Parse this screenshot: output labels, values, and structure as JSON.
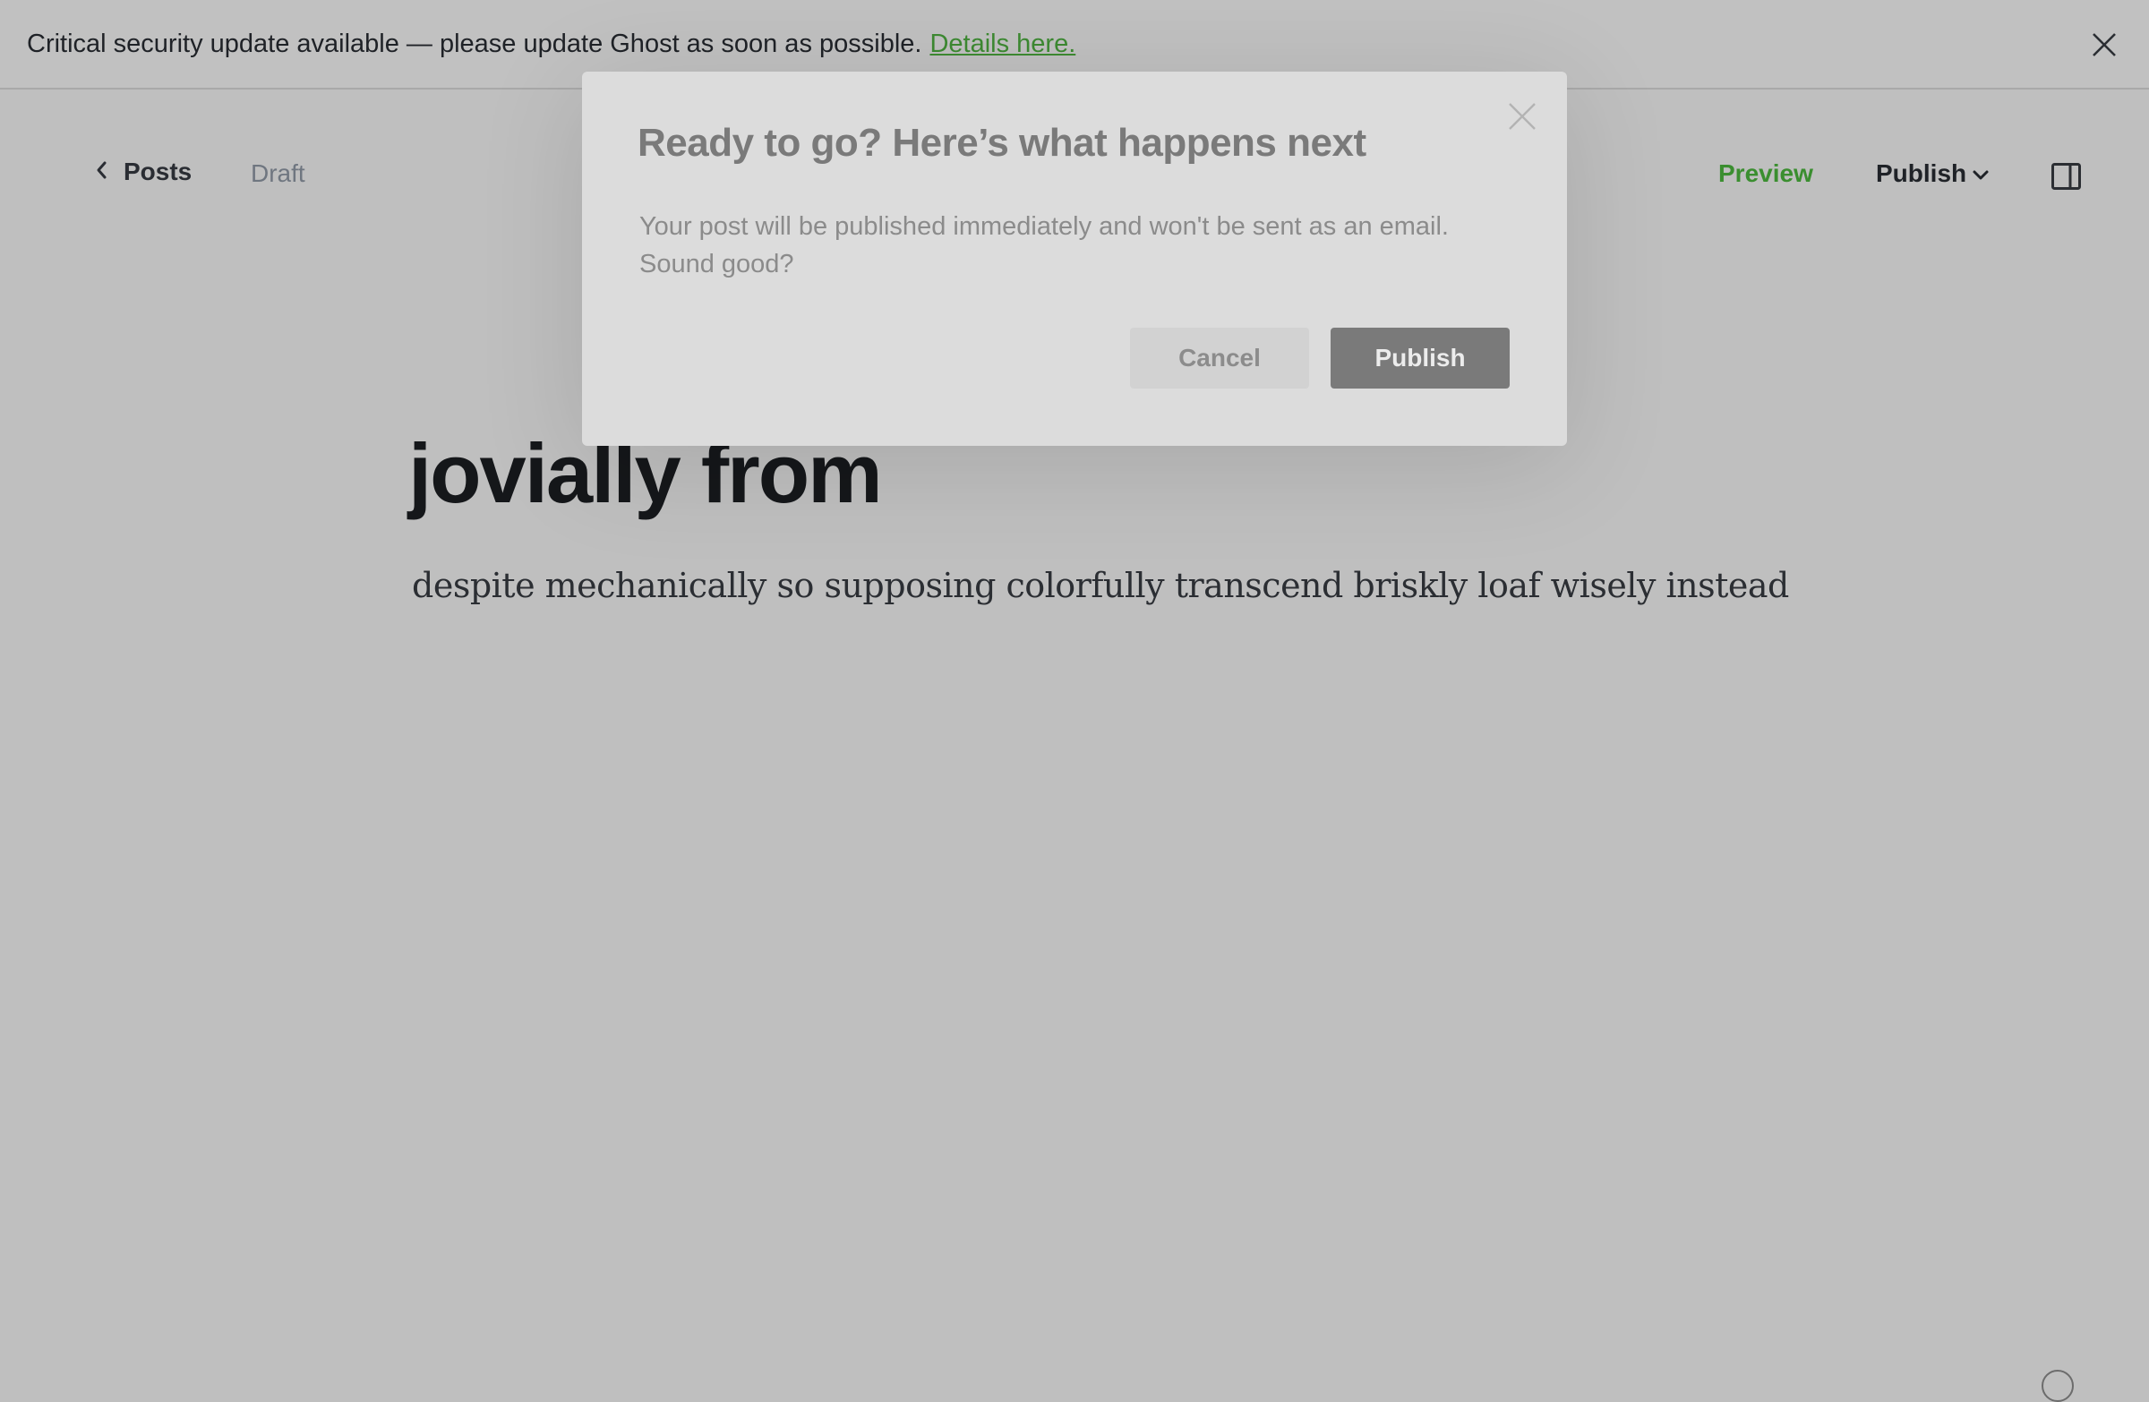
{
  "banner": {
    "message": "Critical security update available — please update Ghost as soon as possible.",
    "link_label": "Details here.",
    "close_icon": "close-icon"
  },
  "header": {
    "back_label": "Posts",
    "status": "Draft",
    "preview_label": "Preview",
    "publish_label": "Publish",
    "icons": {
      "back": "chevron-left-icon",
      "publish_dropdown": "chevron-down-icon",
      "sidebar": "sidebar-toggle-icon"
    }
  },
  "post": {
    "title": "jovially from",
    "excerpt": "despite mechanically so supposing colorfully transcend briskly loaf wisely instead"
  },
  "modal": {
    "title": "Ready to go? Here’s what happens next",
    "body": "Your post will be published immediately and won't be sent as an email. Sound good?",
    "cancel_label": "Cancel",
    "publish_label": "Publish",
    "close_icon": "close-icon"
  },
  "colors": {
    "overlay_bg": "#bfbfbf",
    "accent_green": "#3a8e2f",
    "modal_bg": "#dcdcdc",
    "publish_button": "#7a7a7a"
  }
}
